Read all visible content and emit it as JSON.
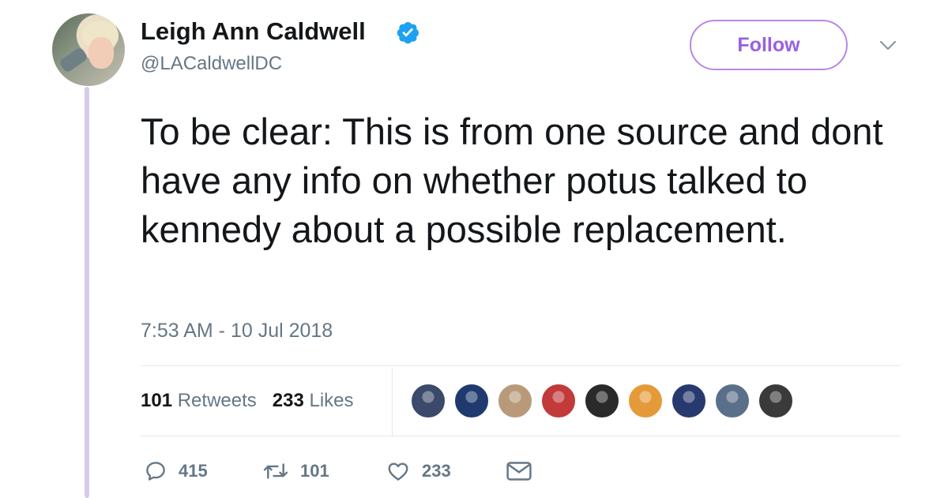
{
  "author": {
    "name": "Leigh Ann Caldwell",
    "handle": "@LACaldwellDC",
    "verified": true
  },
  "follow_button": {
    "label": "Follow"
  },
  "tweet": {
    "text": "To be clear: This is from one source and dont have any info on whether potus talked to kennedy about a possible replacement.",
    "timestamp": "7:53 AM - 10 Jul 2018"
  },
  "stats": {
    "retweets_count": "101",
    "retweets_label": "Retweets",
    "likes_count": "233",
    "likes_label": "Likes"
  },
  "likers": [
    {
      "icon": "liker-avatar-group-photo",
      "color": "#3b4a6b"
    },
    {
      "icon": "liker-avatar-yankees-logo",
      "color": "#1f3a6e"
    },
    {
      "icon": "liker-avatar-man-glasses",
      "color": "#b89a7a"
    },
    {
      "icon": "liker-avatar-man-red",
      "color": "#c23a3a"
    },
    {
      "icon": "liker-avatar-eagle",
      "color": "#2a2a2a"
    },
    {
      "icon": "liker-avatar-cartoon-tiger",
      "color": "#e59a3a"
    },
    {
      "icon": "liker-avatar-quote-text",
      "color": "#273a6e"
    },
    {
      "icon": "liker-avatar-cat",
      "color": "#5a6f8a"
    },
    {
      "icon": "liker-avatar-dark",
      "color": "#3a3a3a"
    }
  ],
  "actions": {
    "reply_count": "415",
    "retweet_count": "101",
    "like_count": "233"
  },
  "colors": {
    "accent": "#9a5fe0",
    "verified_badge": "#1da1f2",
    "muted_text": "#657786",
    "thread_line": "#d8cbe9"
  }
}
